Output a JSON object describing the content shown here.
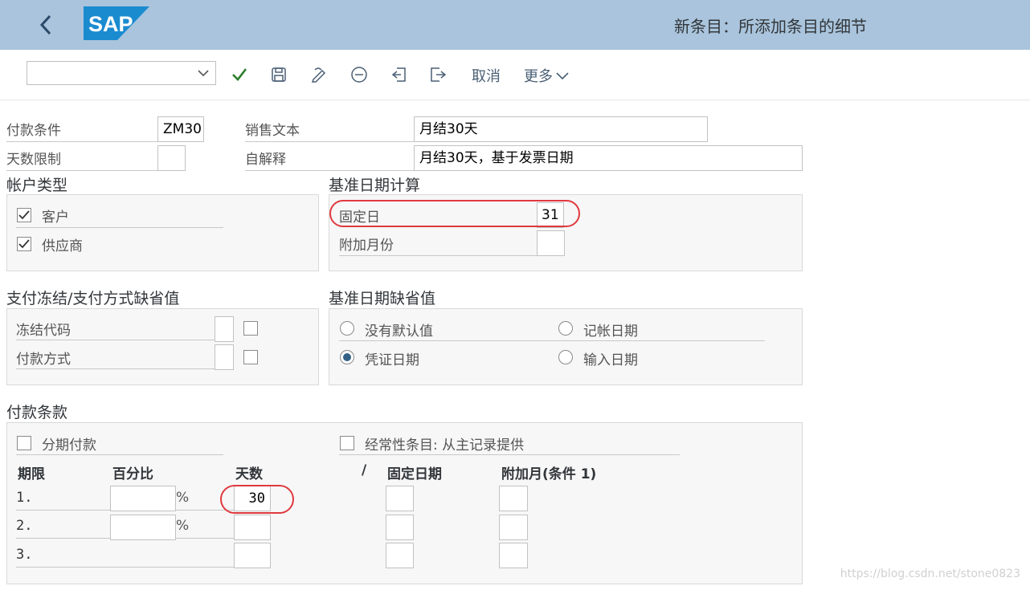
{
  "header": {
    "title": "新条目：所添加条目的细节",
    "logo_text": "SAP"
  },
  "toolbar": {
    "command_value": "",
    "icons": [
      "check-icon",
      "save-icon",
      "edit-icon",
      "minus-circle-icon",
      "back-document-icon",
      "export-icon"
    ],
    "cancel_label": "取消",
    "more_label": "更多"
  },
  "form": {
    "payment_terms_label": "付款条件",
    "payment_terms_value": "ZM30",
    "sales_text_label": "销售文本",
    "sales_text_value": "月结30天",
    "day_limit_label": "天数限制",
    "day_limit_value": "",
    "own_explanation_label": "自解释",
    "own_explanation_value": "月结30天，基于发票日期"
  },
  "account_type": {
    "title": "帐户类型",
    "customer_label": "客户",
    "customer_checked": true,
    "vendor_label": "供应商",
    "vendor_checked": true
  },
  "baseline_calc": {
    "title": "基准日期计算",
    "fixed_day_label": "固定日",
    "fixed_day_value": "31",
    "additional_months_label": "附加月份",
    "additional_months_value": ""
  },
  "payment_block": {
    "title": "支付冻结/支付方式缺省值",
    "block_key_label": "冻结代码",
    "payment_method_label": "付款方式"
  },
  "baseline_default": {
    "title": "基准日期缺省值",
    "no_default_label": "没有默认值",
    "posting_date_label": "记帐日期",
    "document_date_label": "凭证日期",
    "entry_date_label": "输入日期",
    "selected": "document_date"
  },
  "terms": {
    "title": "付款条款",
    "installment_label": "分期付款",
    "recurring_label": "经常性条目: 从主记录提供",
    "col_term": "期限",
    "col_percent": "百分比",
    "col_days": "天数",
    "col_slash": "/",
    "col_fixed_date": "固定日期",
    "col_add_month": "附加月(条件 1)",
    "percent_sign": "%",
    "rows": [
      {
        "term": "1.",
        "percent": "",
        "days": "30",
        "fixed_date": "",
        "add_month": ""
      },
      {
        "term": "2.",
        "percent": "",
        "days": "",
        "fixed_date": "",
        "add_month": ""
      },
      {
        "term": "3.",
        "days": "",
        "fixed_date": "",
        "add_month": ""
      }
    ]
  },
  "watermark": "https://blog.csdn.net/stone0823",
  "colors": {
    "header_bg": "#a9c4dc",
    "check_green": "#2b7d2b",
    "highlight_red": "#e0393e",
    "radio_selected": "#346187"
  }
}
